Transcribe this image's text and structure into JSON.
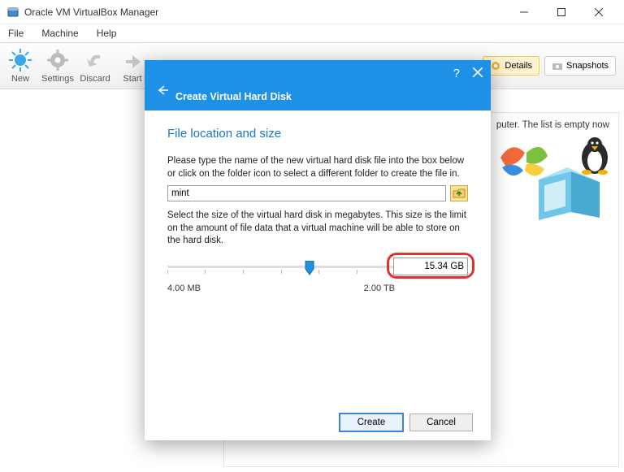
{
  "window": {
    "title": "Oracle VM VirtualBox Manager"
  },
  "menus": {
    "file": "File",
    "machine": "Machine",
    "help": "Help"
  },
  "toolbar": {
    "new": "New",
    "settings": "Settings",
    "discard": "Discard",
    "start": "Start"
  },
  "header_tabs": {
    "details": "Details",
    "snapshots": "Snapshots"
  },
  "panel": {
    "empty_tail": "puter. The list is empty now"
  },
  "dialog": {
    "title": "Create Virtual Hard Disk",
    "section": "File location and size",
    "para1": "Please type the name of the new virtual hard disk file into the box below or click on the folder icon to select a different folder to create the file in.",
    "filename": "mint",
    "para2": "Select the size of the virtual hard disk in megabytes. This size is the limit on the amount of file data that a virtual machine will be able to store on the hard disk.",
    "slider": {
      "min_label": "4.00 MB",
      "max_label": "2.00 TB",
      "value": "15.34 GB"
    },
    "create": "Create",
    "cancel": "Cancel"
  }
}
